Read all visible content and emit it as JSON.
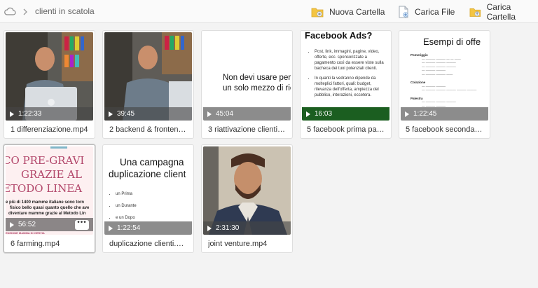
{
  "breadcrumb": {
    "folder": "clienti in scatola"
  },
  "toolbar": {
    "new_folder": "Nuova Cartella",
    "upload_file": "Carica File",
    "upload_folder": "Carica Cartella"
  },
  "colors": {
    "folder_yellow": "#f4c542",
    "bar_green": "#1b5e20",
    "tile_bg": "#ffffff"
  },
  "files": [
    {
      "name": "1 differenziazione.mp4",
      "duration": "1:22:33"
    },
    {
      "name": "2 backend & fronten…",
      "duration": "39:45"
    },
    {
      "name": "3 riattivazione clienti…",
      "duration": "45:04",
      "slide": {
        "line1": "Non devi usare per",
        "line2": "un solo mezzo di rico"
      }
    },
    {
      "name": "5 facebook prima pa…",
      "duration": "16:03",
      "slide": {
        "title": "Facebook Ads?",
        "bullet1": "Post, link, immagini, pagine, video, offerte, ecc. sponsorizzate a pagamento così da essere viste sulla bacheca dei tuoi potenziali clienti.",
        "bullet2": "In quanti la vedranno dipende da molteplici fattori, quali: budget, rilevanza dell'offerta, ampiezza del pubblico, interazioni, eccetera."
      }
    },
    {
      "name": "5 facebook seconda …",
      "duration": "1:22:45",
      "slide": {
        "title": "Esempi di offe",
        "sec1": "Pomeriggio",
        "sec2": "Colazione",
        "sec3": "Palestra"
      }
    },
    {
      "name": "6 farming.mp4",
      "duration": "56:52",
      "slide": {
        "line1": "CO PRE-GRAVI",
        "line2": "GRAZIE AL",
        "line3": "ETODO LINEA",
        "sub1": "e più di 1400 mamme italiane sono torn",
        "sub2": "fisico bello quasi quanto quello che ave",
        "sub3": "diventare mamme grazie al Metodo Lin",
        "footer": "ENZIONE MAMMA DI CERVIA"
      },
      "selected": true,
      "more": "•••"
    },
    {
      "name": "duplicazione clienti.…",
      "duration": "1:22:54",
      "slide": {
        "line1": "Una campagna",
        "line2": "duplicazione client",
        "b1": "un Prima",
        "b2": "un Durante",
        "b3": "e un Dopo"
      }
    },
    {
      "name": "joint venture.mp4",
      "duration": "2:31:30"
    }
  ]
}
